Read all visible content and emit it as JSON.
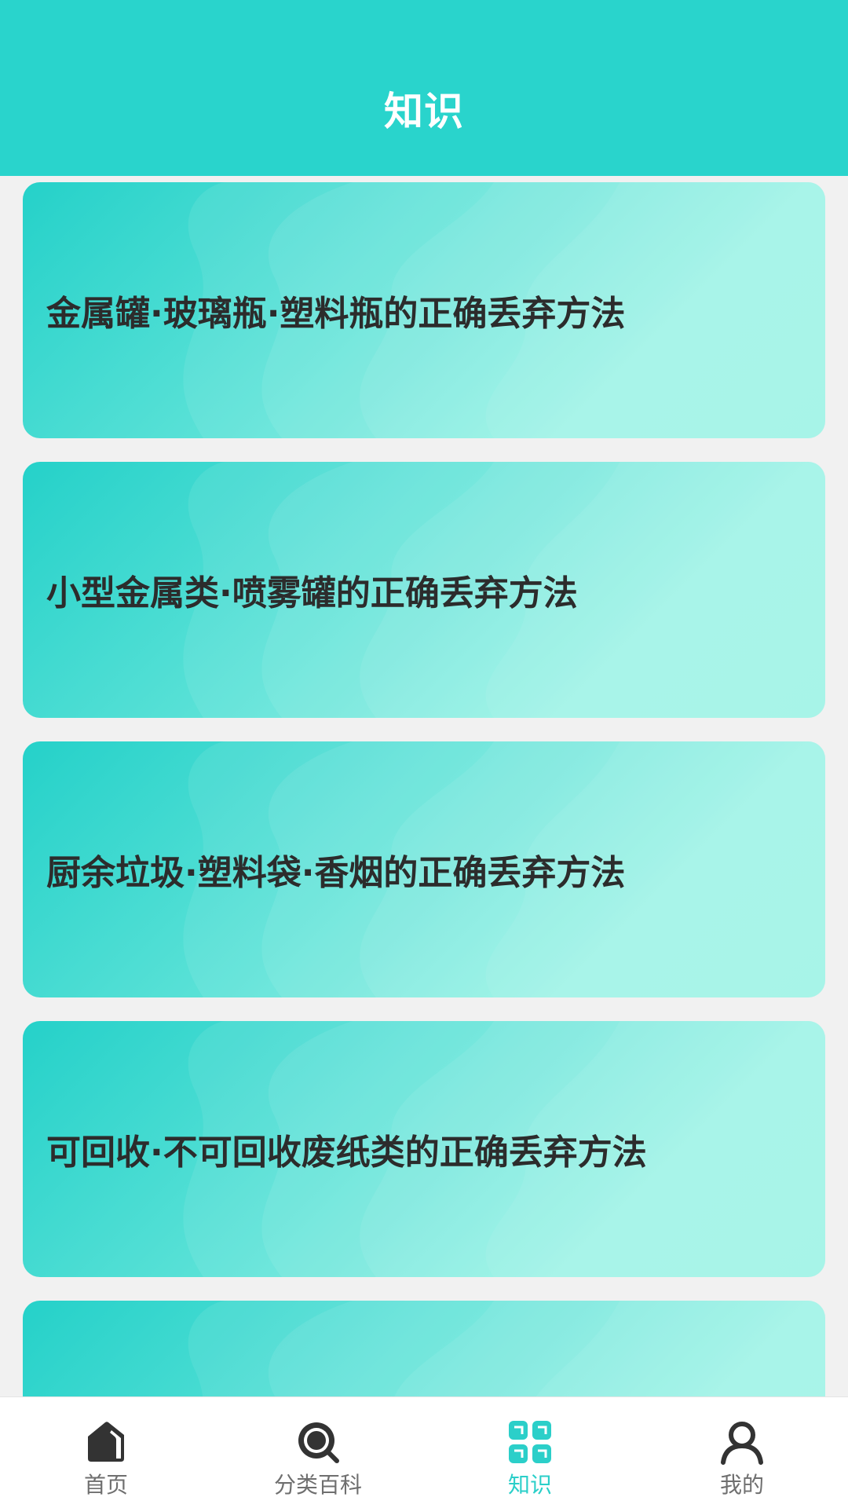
{
  "header": {
    "title": "知识"
  },
  "articles": [
    {
      "title": "金属罐·玻璃瓶·塑料瓶的正确丢弃方法"
    },
    {
      "title": "小型金属类·喷雾罐的正确丢弃方法"
    },
    {
      "title": "厨余垃圾·塑料袋·香烟的正确丢弃方法"
    },
    {
      "title": "可回收·不可回收废纸类的正确丢弃方法"
    },
    {
      "title": ""
    }
  ],
  "tabbar": {
    "items": [
      {
        "label": "首页",
        "icon": "home-icon"
      },
      {
        "label": "分类百科",
        "icon": "search-icon"
      },
      {
        "label": "知识",
        "icon": "grid-icon",
        "active": true
      },
      {
        "label": "我的",
        "icon": "user-icon"
      }
    ]
  },
  "colors": {
    "header": "#29d4cc",
    "accent": "#2bcfc9",
    "card_start": "#25d1c9",
    "card_end": "#8af3e2",
    "text_dark": "#2c2c2c",
    "tab_inactive": "#6f6f6f"
  }
}
